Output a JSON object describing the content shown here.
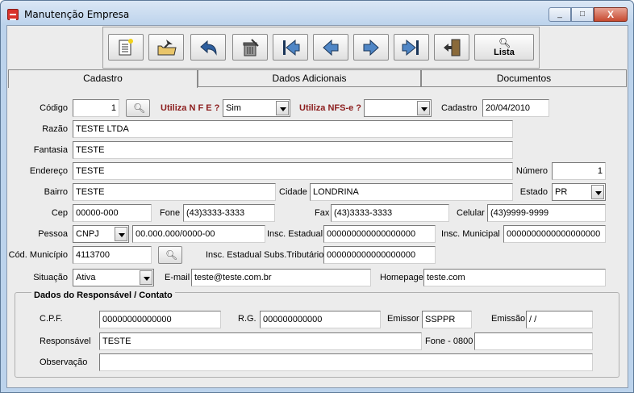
{
  "window": {
    "title": "Manutenção Empresa",
    "minimize": "_",
    "maximize": "□",
    "close": "X"
  },
  "toolbar": {
    "buttons": [
      {
        "icon": "new-document-icon"
      },
      {
        "icon": "open-folder-icon"
      },
      {
        "icon": "undo-arrow-icon"
      },
      {
        "icon": "delete-trash-icon"
      },
      {
        "icon": "first-record-icon"
      },
      {
        "icon": "previous-record-icon"
      },
      {
        "icon": "next-record-icon"
      },
      {
        "icon": "last-record-icon"
      },
      {
        "icon": "exit-door-icon"
      }
    ],
    "lista_label": "Lista"
  },
  "tabs": [
    "Cadastro",
    "Dados Adicionais",
    "Documentos"
  ],
  "form": {
    "codigo_label": "Código",
    "codigo_value": "1",
    "utiliza_nfe_label": "Utiliza N F E ?",
    "utiliza_nfe_value": "Sim",
    "utiliza_nfse_label": "Utiliza NFS-e ?",
    "utiliza_nfse_value": "",
    "cadastro_label": "Cadastro",
    "cadastro_value": "20/04/2010",
    "razao_label": "Razão",
    "razao_value": "TESTE LTDA",
    "fantasia_label": "Fantasia",
    "fantasia_value": "TESTE",
    "endereco_label": "Endereço",
    "endereco_value": "TESTE",
    "numero_label": "Número",
    "numero_value": "1",
    "bairro_label": "Bairro",
    "bairro_value": "TESTE",
    "cidade_label": "Cidade",
    "cidade_value": "LONDRINA",
    "estado_label": "Estado",
    "estado_value": "PR",
    "cep_label": "Cep",
    "cep_value": "00000-000",
    "fone_label": "Fone",
    "fone_value": "(43)3333-3333",
    "fax_label": "Fax",
    "fax_value": "(43)3333-3333",
    "celular_label": "Celular",
    "celular_value": "(43)9999-9999",
    "pessoa_label": "Pessoa",
    "pessoa_value": "CNPJ",
    "cnpj_value": "00.000.000/0000-00",
    "insc_estadual_label": "Insc. Estadual",
    "insc_estadual_value": "000000000000000000",
    "insc_municipal_label": "Insc. Municipal",
    "insc_municipal_value": "0000000000000000000",
    "cod_municipio_label": "Cód. Município",
    "cod_municipio_value": "4113700",
    "insc_subs_label": "Insc. Estadual Subs.Tributário",
    "insc_subs_value": "000000000000000000",
    "situacao_label": "Situação",
    "situacao_value": "Ativa",
    "email_label": "E-mail",
    "email_value": "teste@teste.com.br",
    "homepage_label": "Homepage",
    "homepage_value": "teste.com"
  },
  "responsavel": {
    "group_title": "Dados do Responsável / Contato",
    "cpf_label": "C.P.F.",
    "cpf_value": "00000000000000",
    "rg_label": "R.G.",
    "rg_value": "000000000000",
    "emissor_label": "Emissor",
    "emissor_value": "SSPPR",
    "emissao_label": "Emissão",
    "emissao_value": " / /",
    "responsavel_label": "Responsável",
    "responsavel_value": "TESTE",
    "fone0800_label": "Fone - 0800",
    "fone0800_value": "",
    "observacao_label": "Observação",
    "observacao_value": ""
  }
}
